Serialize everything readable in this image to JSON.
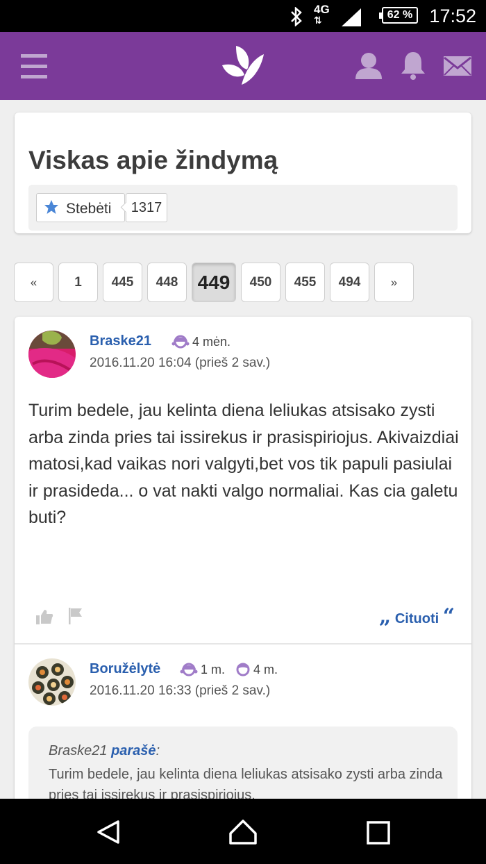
{
  "status_bar": {
    "network": "4G",
    "battery": "62 %",
    "time": "17:52"
  },
  "app_bar": {
    "menu_icon": "hamburger-menu-icon",
    "logo_icon": "butterfly-logo-icon",
    "profile_icon": "user-icon",
    "notifications_icon": "bell-icon",
    "messages_icon": "envelope-icon"
  },
  "topic": {
    "title": "Viskas apie žindymą",
    "follow_label": "Stebėti",
    "follow_count": "1317"
  },
  "pagination": {
    "pages": [
      "«",
      "1",
      "445",
      "448",
      "449",
      "450",
      "455",
      "494",
      "»"
    ],
    "current": "449"
  },
  "posts": [
    {
      "author": "Braske21",
      "badges": [
        "4 mėn."
      ],
      "date": "2016.11.20 16:04 (prieš 2 sav.)",
      "text": "Turim bedele, jau kelinta diena leliukas atsisako zysti arba zinda pries tai issirekus ir prasispiriojus. Akivaizdiai matosi,kad vaikas nori valgyti,bet vos tik papuli pasiulai ir prasideda... o vat nakti valgo normaliai. Kas cia galetu buti?",
      "quote_label": "Cituoti"
    },
    {
      "author": "Boružėlytė",
      "badges": [
        "1 m.",
        "4 m."
      ],
      "date": "2016.11.20 16:33 (prieš 2 sav.)",
      "quote_author": "Braske21",
      "quote_said": "parašė",
      "quote_text": "Turim bedele, jau kelinta diena leliukas atsisako zysti arba zinda pries tai issirekus ir prasispiriojus."
    }
  ],
  "colors": {
    "header": "#7b3a99",
    "link": "#2a5fae",
    "badge": "#a07cc8"
  }
}
